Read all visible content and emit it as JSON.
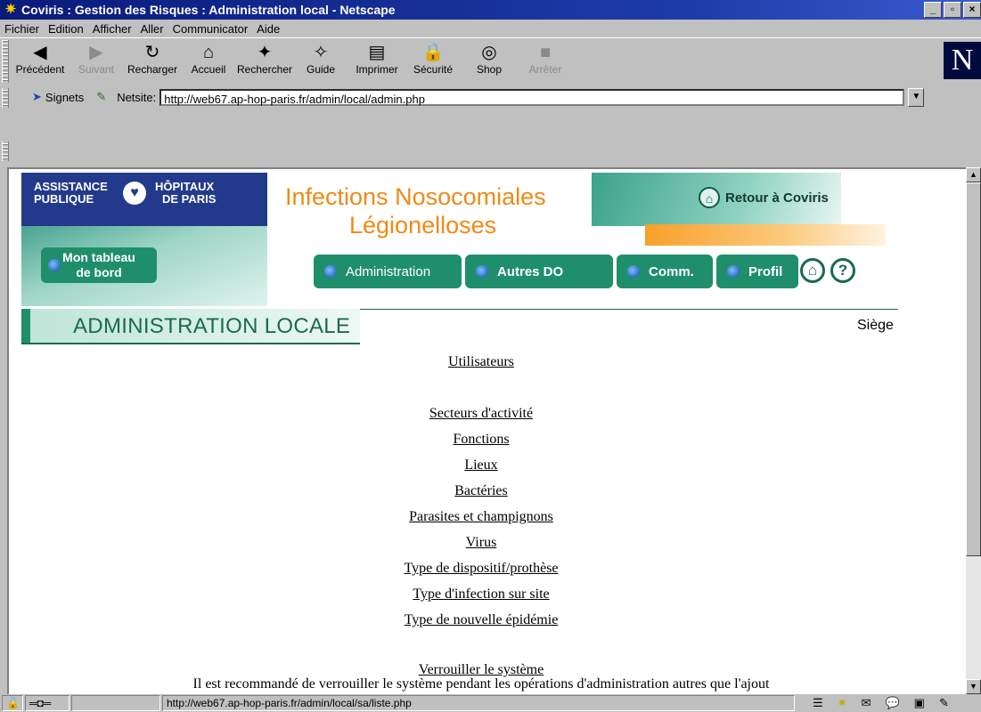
{
  "window": {
    "title": "Coviris : Gestion des Risques : Administration local - Netscape"
  },
  "menu": [
    "Fichier",
    "Edition",
    "Afficher",
    "Aller",
    "Communicator",
    "Aide"
  ],
  "toolbar": {
    "buttons": [
      {
        "label": "Précédent",
        "icon": "back-arrow-icon",
        "disabled": false
      },
      {
        "label": "Suivant",
        "icon": "forward-arrow-icon",
        "disabled": true
      },
      {
        "label": "Recharger",
        "icon": "reload-icon",
        "disabled": false
      },
      {
        "label": "Accueil",
        "icon": "home-icon",
        "disabled": false
      },
      {
        "label": "Rechercher",
        "icon": "search-icon",
        "disabled": false
      },
      {
        "label": "Guide",
        "icon": "guide-icon",
        "disabled": false
      },
      {
        "label": "Imprimer",
        "icon": "printer-icon",
        "disabled": false
      },
      {
        "label": "Sécurité",
        "icon": "lock-icon",
        "disabled": false
      },
      {
        "label": "Shop",
        "icon": "shop-icon",
        "disabled": false
      },
      {
        "label": "Arrêter",
        "icon": "stop-icon",
        "disabled": true
      }
    ],
    "logo": "N"
  },
  "location": {
    "signets": "Signets",
    "netsite_label": "Netsite:",
    "url": "http://web67.ap-hop-paris.fr/admin/local/admin.php"
  },
  "header": {
    "org_left": [
      "ASSISTANCE",
      "PUBLIQUE"
    ],
    "org_right": [
      "HÔPITAUX",
      "DE  PARIS"
    ],
    "title_line1": "Infections Nosocomiales",
    "title_line2": "Légionelloses",
    "coviris": "Retour à Coviris",
    "dashboard": [
      "Mon tableau",
      "de bord"
    ],
    "tabs": [
      "Administration",
      "Autres DO",
      "Comm.",
      "Profil"
    ]
  },
  "section": {
    "title": "ADMINISTRATION LOCALE",
    "site": "Siège"
  },
  "links": [
    {
      "label": "Utilisateurs"
    },
    {
      "label": "Secteurs d'activité"
    },
    {
      "label": "Fonctions"
    },
    {
      "label": "Lieux"
    },
    {
      "label": "Bactéries"
    },
    {
      "label": "Parasites et champignons"
    },
    {
      "label": "Virus"
    },
    {
      "label": "Type de dispositif/prothèse"
    },
    {
      "label": "Type d'infection sur site"
    },
    {
      "label": "Type de nouvelle épidémie"
    },
    {
      "label": "Verrouiller le système"
    }
  ],
  "note": "Il est recommandé de verrouiller le système pendant les opérations d'administration autres que l'ajout",
  "status": {
    "url": "http://web67.ap-hop-paris.fr/admin/local/sa/liste.php"
  },
  "colors": {
    "teal": "#1f8f6b",
    "orange": "#f08a16",
    "aphp_blue": "#233a8c",
    "titlebar": "#0a1a7a"
  }
}
